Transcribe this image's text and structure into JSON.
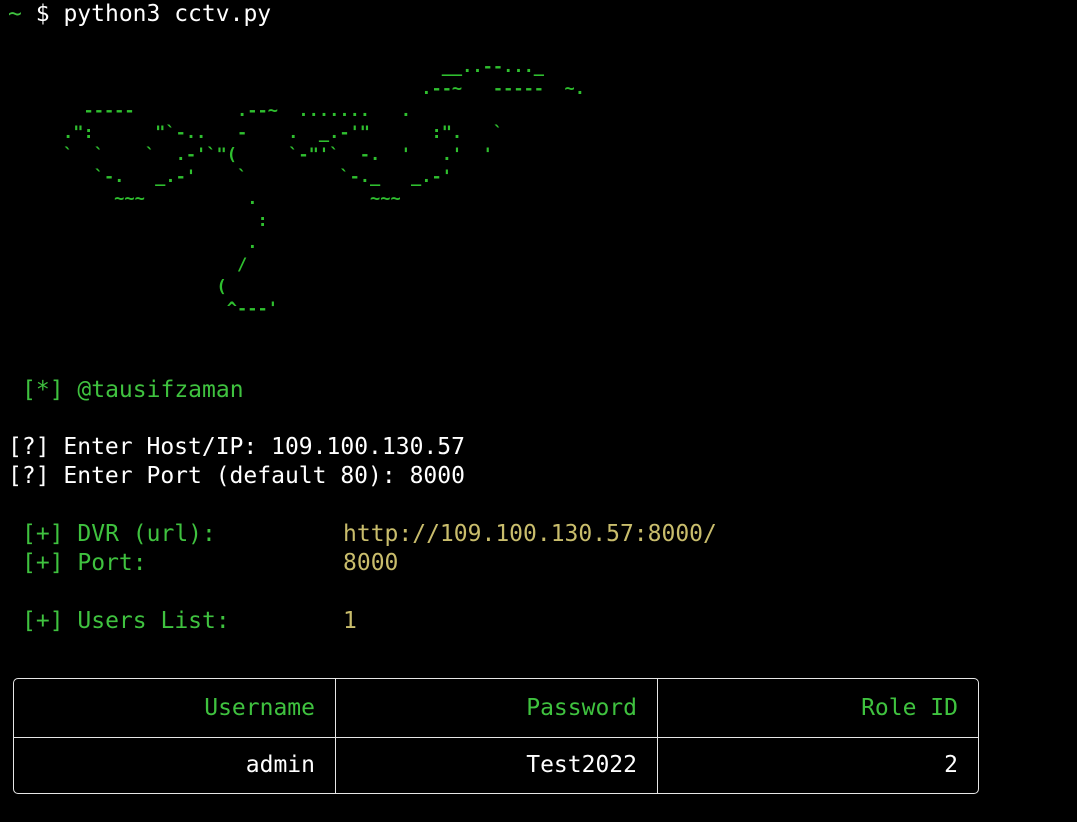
{
  "terminal": {
    "prompt_symbol": "~",
    "prompt_dollar": "$",
    "command": "python3 cctv.py"
  },
  "banner": {
    "ascii_art": "                                     __..--..._\n                                   .--~   -----  ~.\n  -----          .--~  .......   .\n.\":      \"`-..   -    .  _.-'\"      :\".   `\n`  `    `  .-'`\"(     `-\"'`  -.  '   .'  '\n   `-.   _.-'    `         `-._   _.-'\n     ~~~          .           ~~~\n                   :\n                  .\n                 /\n               (\n                ^---'",
    "author": "[*] @tausifzaman"
  },
  "inputs": {
    "host_prompt": "[?] Enter Host/IP: ",
    "host_value": "109.100.130.57",
    "port_prompt": "[?] Enter Port (default 80): ",
    "port_value": "8000"
  },
  "results": {
    "dvr_label": "[+] DVR (url):",
    "dvr_value": "http://109.100.130.57:8000/",
    "port_label": "[+] Port:",
    "port_value": "8000",
    "users_label": "[+] Users List:",
    "users_value": "1"
  },
  "users_table": {
    "headers": [
      "Username",
      "Password",
      "Role ID"
    ],
    "rows": [
      [
        "admin",
        "Test2022",
        "2"
      ]
    ]
  },
  "colors": {
    "background": "#000000",
    "green": "#3fc23f",
    "yellow": "#c9bd6c",
    "text": "#ffffff"
  }
}
